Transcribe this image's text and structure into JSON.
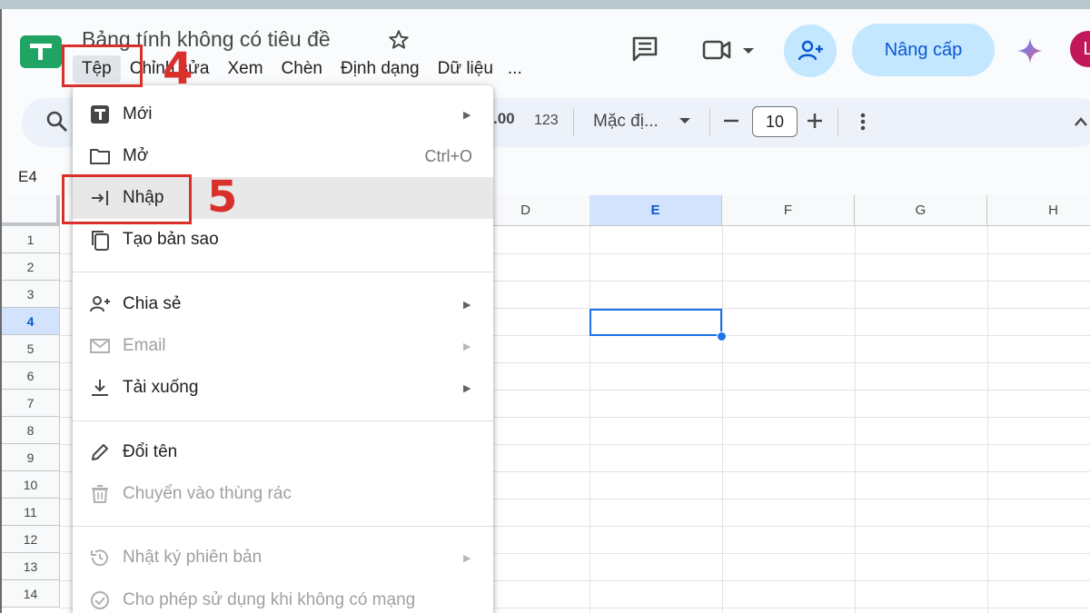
{
  "doc": {
    "title": "Bảng tính không có tiêu đề",
    "menu": [
      "Tệp",
      "Chỉnh sửa",
      "Xem",
      "Chèn",
      "Định dạng",
      "Dữ liệu"
    ],
    "menu_more": "..."
  },
  "header": {
    "upgrade_label": "Nâng cấp",
    "avatar_initial": "L",
    "icons": [
      "comments-icon",
      "meet-video-icon",
      "share-add-person-icon",
      "gemini-sparkle-icon"
    ]
  },
  "toolbar": {
    "decimal_label": ".00",
    "number_format_label": "123",
    "font_label": "Mặc đị...",
    "font_size": "10",
    "minus": "—",
    "plus": "+"
  },
  "namebox": "E4",
  "grid": {
    "columns": [
      "D",
      "E",
      "F",
      "G",
      "H"
    ],
    "selected_column": "E",
    "rows": [
      "1",
      "2",
      "3",
      "4",
      "5",
      "6",
      "7",
      "8",
      "9",
      "10",
      "11",
      "12",
      "13",
      "14"
    ],
    "selected_row": "4",
    "selected_color": "#1a73e8"
  },
  "file_menu": {
    "items": [
      {
        "label": "Mới",
        "icon": "new-sheet-icon",
        "submenu": true,
        "disabled": false
      },
      {
        "label": "Mở",
        "icon": "folder-icon",
        "shortcut": "Ctrl+O",
        "disabled": false
      },
      {
        "label": "Nhập",
        "icon": "import-icon",
        "disabled": false,
        "highlighted": true
      },
      {
        "label": "Tạo bản sao",
        "icon": "copy-icon",
        "disabled": false
      },
      {
        "label": "Chia sẻ",
        "icon": "share-person-icon",
        "submenu": true,
        "disabled": false
      },
      {
        "label": "Email",
        "icon": "email-icon",
        "submenu": true,
        "disabled": true
      },
      {
        "label": "Tải xuống",
        "icon": "download-icon",
        "submenu": true,
        "disabled": false
      },
      {
        "label": "Đổi tên",
        "icon": "pencil-icon",
        "disabled": false
      },
      {
        "label": "Chuyển vào thùng rác",
        "icon": "trash-icon",
        "disabled": true
      },
      {
        "label": "Nhật ký phiên bản",
        "icon": "history-icon",
        "submenu": true,
        "disabled": true
      },
      {
        "label": "Cho phép sử dụng khi không có mạng",
        "icon": "offline-icon",
        "disabled": true
      }
    ],
    "arrow_glyph": "▶"
  },
  "annotations": {
    "step4": "4",
    "step5": "5",
    "color": "#d9302c"
  }
}
